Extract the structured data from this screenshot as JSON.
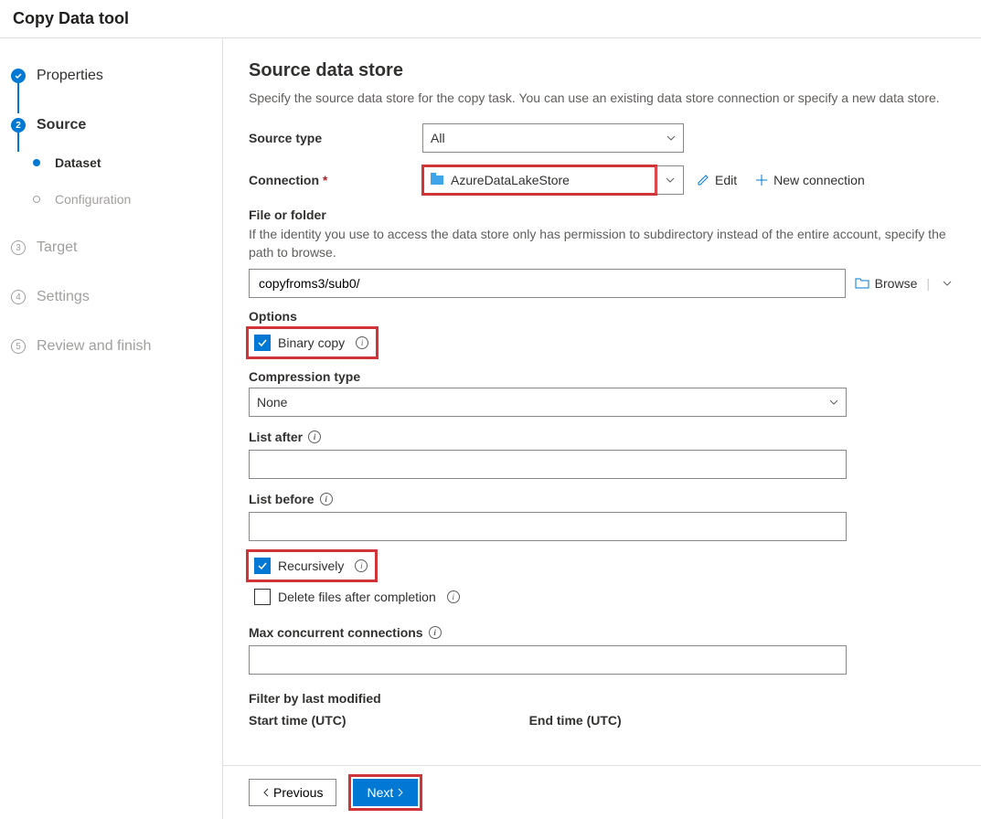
{
  "header": {
    "title": "Copy Data tool"
  },
  "sidebar": {
    "steps": [
      {
        "label": "Properties",
        "num": "✓"
      },
      {
        "label": "Source",
        "num": "2"
      },
      {
        "label": "Dataset"
      },
      {
        "label": "Configuration"
      },
      {
        "label": "Target",
        "num": "3"
      },
      {
        "label": "Settings",
        "num": "4"
      },
      {
        "label": "Review and finish",
        "num": "5"
      }
    ]
  },
  "main": {
    "title": "Source data store",
    "description": "Specify the source data store for the copy task. You can use an existing data store connection or specify a new data store.",
    "sourceTypeLabel": "Source type",
    "sourceTypeValue": "All",
    "connectionLabel": "Connection",
    "connectionValue": "AzureDataLakeStore",
    "editLabel": "Edit",
    "newConnLabel": "New connection",
    "fileFolderLabel": "File or folder",
    "fileFolderHelp": "If the identity you use to access the data store only has permission to subdirectory instead of the entire account, specify the path to browse.",
    "pathValue": "copyfroms3/sub0/",
    "browseLabel": "Browse",
    "optionsLabel": "Options",
    "binaryCopyLabel": "Binary copy",
    "compressionLabel": "Compression type",
    "compressionValue": "None",
    "listAfterLabel": "List after",
    "listBeforeLabel": "List before",
    "recursivelyLabel": "Recursively",
    "deleteFilesLabel": "Delete files after completion",
    "maxConnLabel": "Max concurrent connections",
    "filterLabel": "Filter by last modified",
    "startTimeLabel": "Start time (UTC)",
    "endTimeLabel": "End time (UTC)"
  },
  "footer": {
    "previous": "Previous",
    "next": "Next"
  }
}
